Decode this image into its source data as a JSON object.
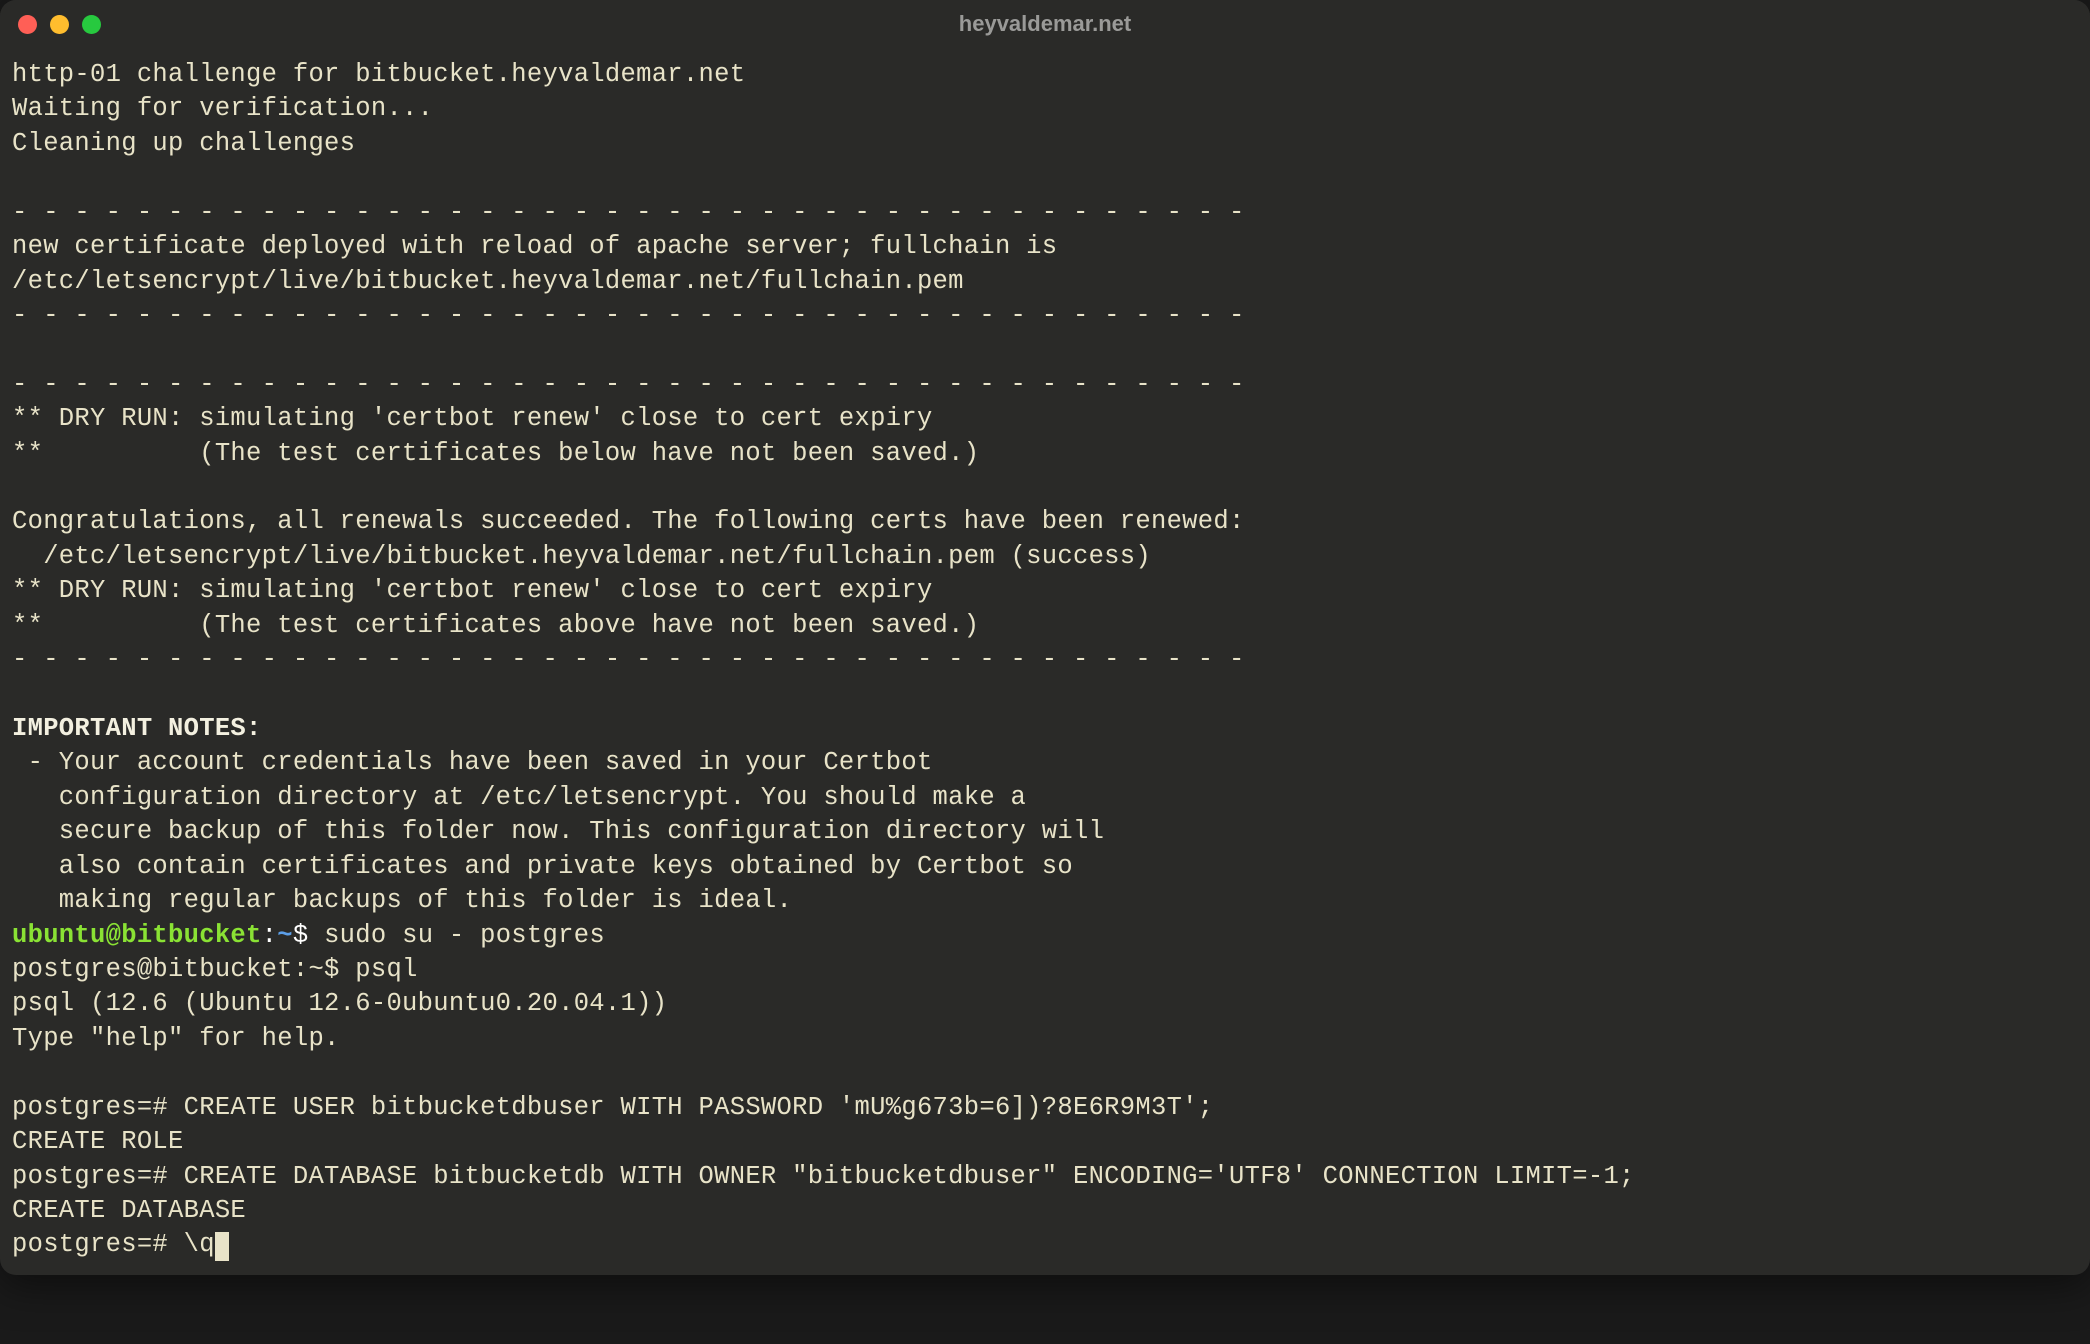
{
  "window_title": "heyvaldemar.net",
  "lines": {
    "l0": "http-01 challenge for bitbucket.heyvaldemar.net",
    "l1": "Waiting for verification...",
    "l2": "Cleaning up challenges",
    "l3": "",
    "l4": "- - - - - - - - - - - - - - - - - - - - - - - - - - - - - - - - - - - - - - - -",
    "l5": "new certificate deployed with reload of apache server; fullchain is",
    "l6": "/etc/letsencrypt/live/bitbucket.heyvaldemar.net/fullchain.pem",
    "l7": "- - - - - - - - - - - - - - - - - - - - - - - - - - - - - - - - - - - - - - - -",
    "l8": "",
    "l9": "- - - - - - - - - - - - - - - - - - - - - - - - - - - - - - - - - - - - - - - -",
    "l10": "** DRY RUN: simulating 'certbot renew' close to cert expiry",
    "l11": "**          (The test certificates below have not been saved.)",
    "l12": "",
    "l13": "Congratulations, all renewals succeeded. The following certs have been renewed:",
    "l14": "  /etc/letsencrypt/live/bitbucket.heyvaldemar.net/fullchain.pem (success)",
    "l15": "** DRY RUN: simulating 'certbot renew' close to cert expiry",
    "l16": "**          (The test certificates above have not been saved.)",
    "l17": "- - - - - - - - - - - - - - - - - - - - - - - - - - - - - - - - - - - - - - - -",
    "l18": "",
    "l19": "IMPORTANT NOTES:",
    "l20": " - Your account credentials have been saved in your Certbot",
    "l21": "   configuration directory at /etc/letsencrypt. You should make a",
    "l22": "   secure backup of this folder now. This configuration directory will",
    "l23": "   also contain certificates and private keys obtained by Certbot so",
    "l24": "   making regular backups of this folder is ideal.",
    "prompt1_user": "ubuntu@bitbucket",
    "prompt1_sep": ":",
    "prompt1_path": "~",
    "prompt1_sym": "$ ",
    "prompt1_cmd": "sudo su - postgres",
    "l26": "postgres@bitbucket:~$ psql",
    "l27": "psql (12.6 (Ubuntu 12.6-0ubuntu0.20.04.1))",
    "l28": "Type \"help\" for help.",
    "l29": "",
    "l30": "postgres=# CREATE USER bitbucketdbuser WITH PASSWORD 'mU%g673b=6])?8E6R9M3T';",
    "l31": "CREATE ROLE",
    "l32": "postgres=# CREATE DATABASE bitbucketdb WITH OWNER \"bitbucketdbuser\" ENCODING='UTF8' CONNECTION LIMIT=-1;",
    "l33": "CREATE DATABASE",
    "l34_prompt": "postgres=# ",
    "l34_cmd": "\\q"
  }
}
